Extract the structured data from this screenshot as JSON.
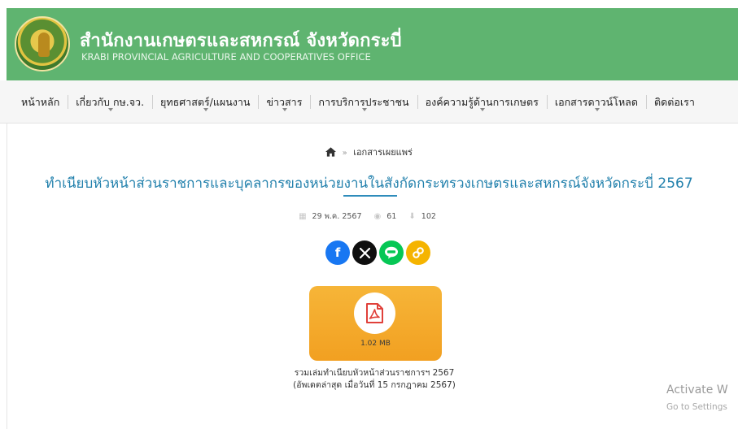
{
  "header": {
    "title_th": "สำนักงานเกษตรและสหกรณ์ จังหวัดกระบี่",
    "title_en": "KRABI PROVINCIAL AGRICULTURE AND COOPERATIVES OFFICE",
    "bg_color": "#5fb470"
  },
  "nav": {
    "items": [
      {
        "label": "หน้าหลัก",
        "dropdown": false
      },
      {
        "label": "เกี่ยวกับ กษ.จว.",
        "dropdown": true
      },
      {
        "label": "ยุทธศาสตร์/แผนงาน",
        "dropdown": true
      },
      {
        "label": "ข่าวสาร",
        "dropdown": true
      },
      {
        "label": "การบริการประชาชน",
        "dropdown": true
      },
      {
        "label": "องค์ความรู้ด้านการเกษตร",
        "dropdown": true
      },
      {
        "label": "เอกสารดาวน์โหลด",
        "dropdown": true
      },
      {
        "label": "ติดต่อเรา",
        "dropdown": false
      }
    ]
  },
  "breadcrumb": {
    "home_icon": "home-icon",
    "separator": "»",
    "current": "เอกสารเผยแพร่"
  },
  "document": {
    "title": "ทำเนียบหัวหน้าส่วนราชการและบุคลากรของหน่วยงานในสังกัดกระทรวงเกษตรและสหกรณ์จังหวัดกระบี่ 2567",
    "title_color": "#2180ac",
    "date": "29 พ.ค. 2567",
    "views": "61",
    "downloads": "102"
  },
  "share": {
    "facebook_label": "f",
    "icons": [
      "facebook-icon",
      "x-icon",
      "line-icon",
      "link-icon"
    ]
  },
  "download": {
    "file_size": "1.02 MB",
    "icon": "pdf-icon",
    "caption_line1": "รวมเล่มทำเนียบหัวหน้าส่วนราชการฯ 2567",
    "caption_line2": "(อัพเดตล่าสุด เมื่อวันที่ 15 กรกฎาคม 2567)"
  },
  "watermark": {
    "line1": "Activate W",
    "line2": "Go to Settings"
  }
}
